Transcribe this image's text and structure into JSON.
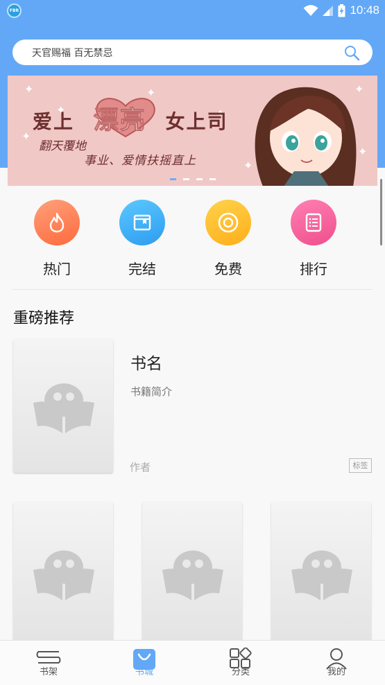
{
  "status_bar": {
    "time": "10:48",
    "app_badge": "FBR"
  },
  "search": {
    "placeholder": "天官赐福 百无禁忌",
    "icon": "search-icon"
  },
  "banner": {
    "title_left": "爱上",
    "title_big": "漂亮",
    "title_right": "女上司",
    "subtitle1": "翻天覆地",
    "subtitle2": "事业、爱情扶摇直上",
    "page_count": 4,
    "active_page": 0
  },
  "categories": [
    {
      "label": "热门",
      "icon": "flame-icon",
      "color_from": "#ffa07a",
      "color_to": "#ff6a3d"
    },
    {
      "label": "完结",
      "icon": "book-icon",
      "color_from": "#5bc8ff",
      "color_to": "#2d9cf0"
    },
    {
      "label": "免费",
      "icon": "coin-icon",
      "color_from": "#ffd24a",
      "color_to": "#ffae1a"
    },
    {
      "label": "排行",
      "icon": "list-icon",
      "color_from": "#ff7fb3",
      "color_to": "#ef4f8c"
    }
  ],
  "section": {
    "title": "重磅推荐"
  },
  "featured_book": {
    "name": "书名",
    "intro": "书籍简介",
    "author": "作者",
    "tag": "标签"
  },
  "tabbar": {
    "accent": "#62a8f7",
    "items": [
      {
        "label": "书架",
        "icon": "bookshelf-icon"
      },
      {
        "label": "书城",
        "icon": "bookstore-icon",
        "active": true
      },
      {
        "label": "分类",
        "icon": "category-icon"
      },
      {
        "label": "我的",
        "icon": "profile-icon"
      }
    ]
  }
}
